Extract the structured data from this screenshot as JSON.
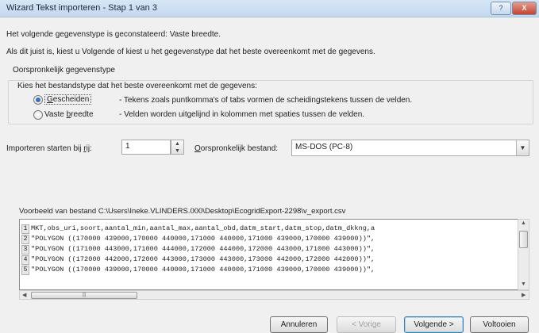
{
  "window": {
    "title": "Wizard Tekst importeren - Stap 1 van 3",
    "help_btn": "?",
    "close_btn": "X"
  },
  "intro": {
    "line1": "Het volgende gegevenstype is geconstateerd: Vaste breedte.",
    "line2": "Als dit juist is, kiest u Volgende of kiest u het gegevenstype dat het beste overeenkomt met de gegevens."
  },
  "group": {
    "title": "Oorspronkelijk gegevenstype",
    "prompt": "Kies het bestandstype dat het beste overeenkomt met de gegevens:",
    "options": [
      {
        "label": "Gescheiden",
        "desc": "- Tekens zoals puntkomma's of tabs vormen de scheidingstekens tussen de velden.",
        "checked": true
      },
      {
        "label": "Vaste breedte",
        "desc": "- Velden worden uitgelijnd in kolommen met spaties tussen de velden.",
        "checked": false
      }
    ]
  },
  "import": {
    "start_label": "Importeren starten bij rij:",
    "start_value": "1",
    "origin_label": "Oorspronkelijk bestand:",
    "origin_value": "MS-DOS (PC-8)"
  },
  "preview": {
    "label": "Voorbeeld van bestand C:\\Users\\Ineke.VLINDERS.000\\Desktop\\EcogridExport-2298\\v_export.csv",
    "rows": [
      {
        "num": "1",
        "text": "MKT,obs_uri,soort,aantal_min,aantal_max,aantal_obd,datm_start,datm_stop,datm_dkkng,a"
      },
      {
        "num": "2",
        "text": "\"POLYGON ((170000 439000,170000 440000,171000 440000,171000 439000,170000 439000))\","
      },
      {
        "num": "3",
        "text": "\"POLYGON ((171000 443000,171000 444000,172000 444000,172000 443000,171000 443000))\","
      },
      {
        "num": "4",
        "text": "\"POLYGON ((172000 442000,172000 443000,173000 443000,173000 442000,172000 442000))\","
      },
      {
        "num": "5",
        "text": "\"POLYGON ((170000 439000,170000 440000,171000 440000,171000 439000,170000 439000))\","
      }
    ]
  },
  "buttons": {
    "cancel": "Annuleren",
    "back": "< Vorige",
    "next": "Volgende >",
    "finish": "Voltooien"
  }
}
